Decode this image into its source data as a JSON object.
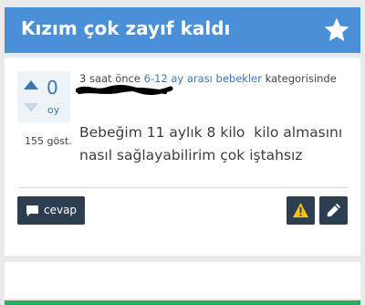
{
  "question": {
    "title": "Kızım çok zayıf kaldı",
    "votes": "0",
    "votes_unit": "oy",
    "views": "155 göst.",
    "meta_time": "3 saat önce ",
    "meta_category": "6-12 ay arası bebekler",
    "meta_suffix": " kategorisinde",
    "body": "Bebeğim 11 aylık 8 kilo  kilo almasını nasıl sağlayabilirim çok iştahsız"
  },
  "actions": {
    "answer_label": "cevap"
  },
  "colors": {
    "header": "#4a90d9",
    "link": "#3b77b8",
    "button": "#2c3e50",
    "warning": "#f1c40f",
    "green": "#27ae60"
  },
  "icons": [
    "star-icon",
    "up-arrow-icon",
    "down-arrow-icon",
    "chat-icon",
    "warning-icon",
    "pencil-icon"
  ]
}
